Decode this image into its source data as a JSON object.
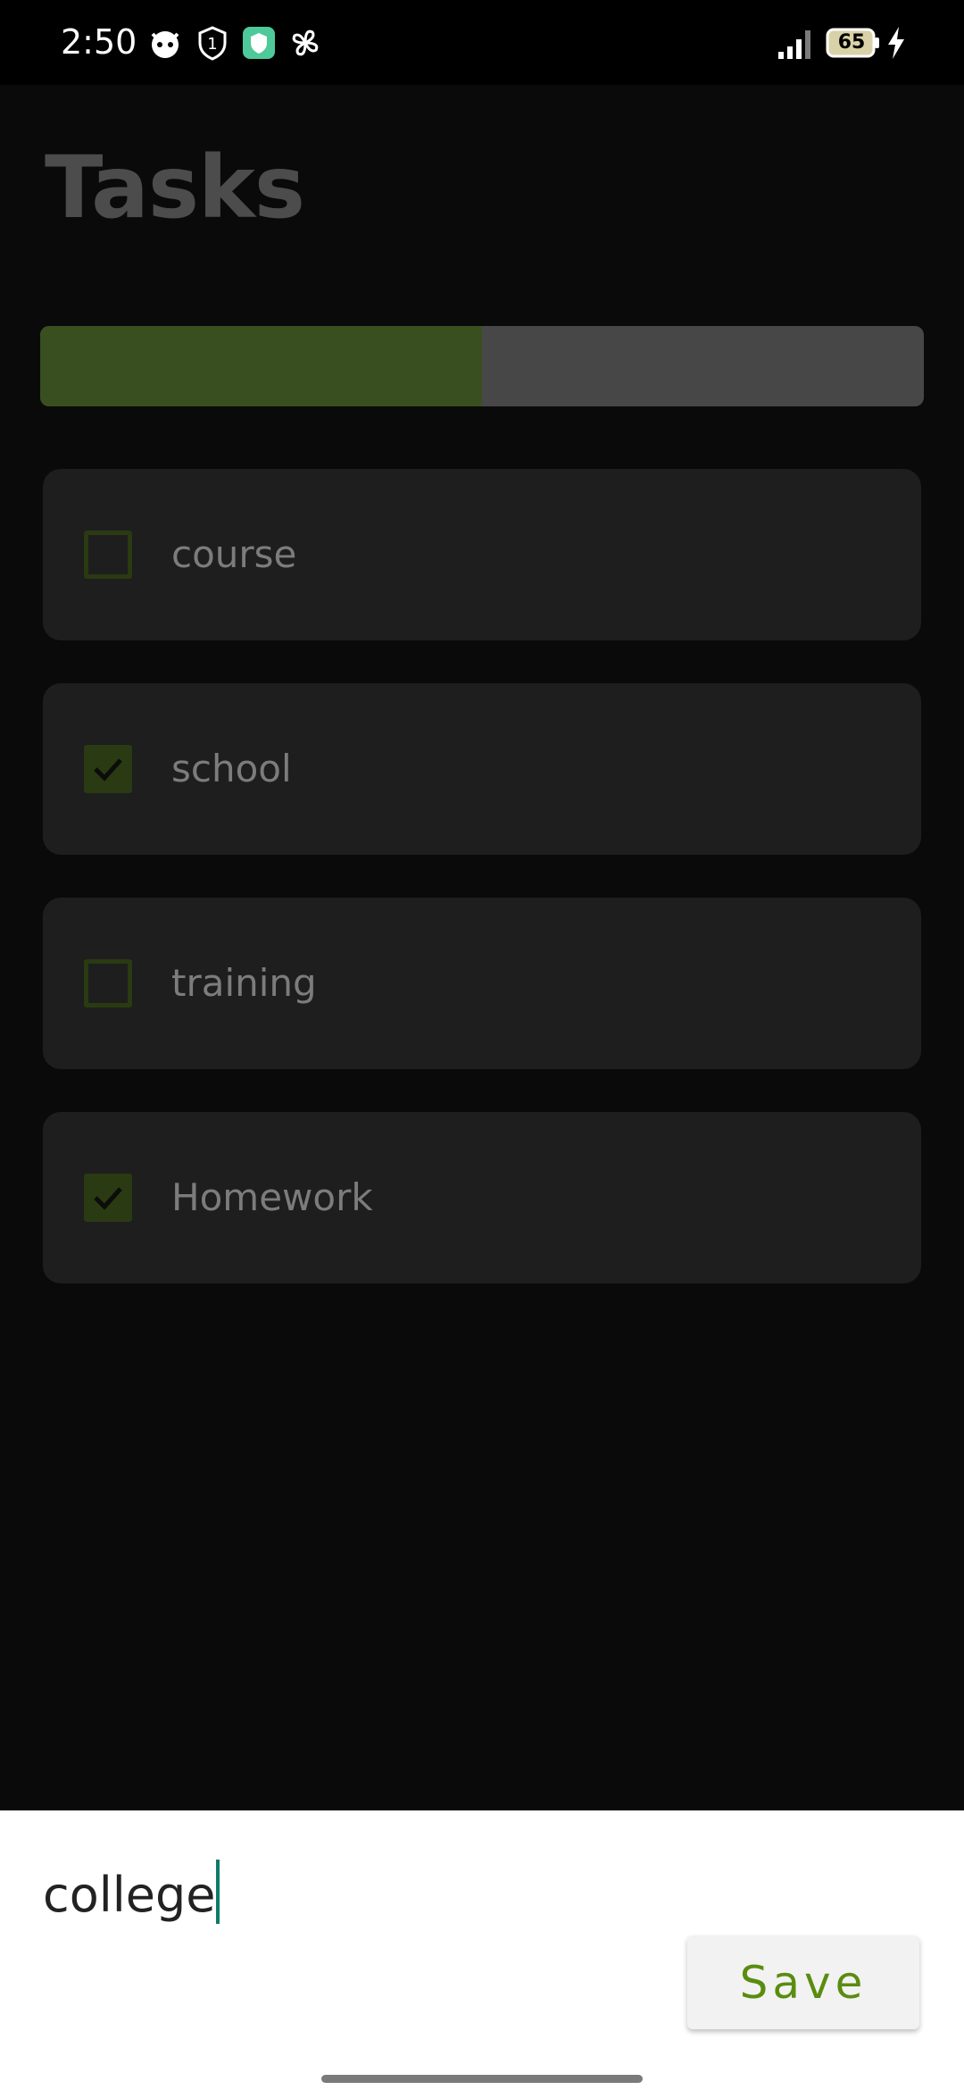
{
  "status_bar": {
    "time": "2:50",
    "battery": "65",
    "icons": [
      "fox-icon",
      "shield-one-icon",
      "vpn-shield-icon",
      "pinwheel-icon",
      "signal-icon",
      "battery-icon",
      "charging-icon"
    ]
  },
  "app": {
    "title": "Tasks"
  },
  "progress": {
    "completed_fraction": 0.5,
    "fill_color": "#3a4f1f",
    "track_color": "#474747"
  },
  "tasks": [
    {
      "label": "course",
      "checked": false
    },
    {
      "label": "school",
      "checked": true
    },
    {
      "label": "training",
      "checked": false
    },
    {
      "label": "Homework",
      "checked": true
    }
  ],
  "input": {
    "value": "college"
  },
  "actions": {
    "save_label": "Save",
    "accent_color": "#5a8c10"
  }
}
